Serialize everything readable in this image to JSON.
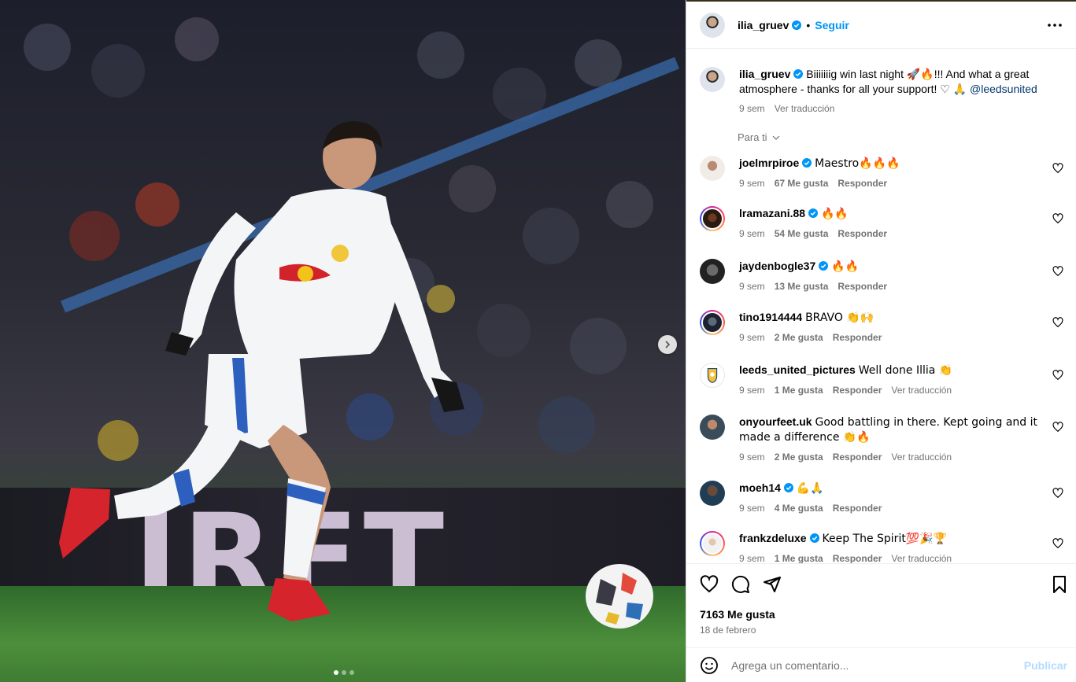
{
  "post": {
    "author": "ilia_gruev",
    "follow_label": "Seguir",
    "separator": "•",
    "caption_pre": "Biiiiiiig win last night ",
    "caption_emoji": "🚀🔥",
    "caption_post": "!!! And what a great atmosphere - thanks for all your support! ♡ 🙏 ",
    "caption_mention": "@leedsunited",
    "caption_age": "9 sem",
    "see_translation": "Ver traducción",
    "filter_label": "Para ti",
    "likes": "7163 Me gusta",
    "date": "18 de febrero"
  },
  "media": {
    "board_text": "IRFT",
    "slides": 3,
    "active_slide": 0
  },
  "comments": [
    {
      "user": "joelmrpiroe",
      "verified": true,
      "text": "Maestro🔥🔥🔥",
      "age": "9 sem",
      "likes": "67 Me gusta",
      "reply": "Responder",
      "translate": ""
    },
    {
      "user": "lramazani.88",
      "verified": true,
      "text": "🔥🔥",
      "age": "9 sem",
      "likes": "54 Me gusta",
      "reply": "Responder",
      "translate": ""
    },
    {
      "user": "jaydenbogle37",
      "verified": true,
      "text": "🔥🔥",
      "age": "9 sem",
      "likes": "13 Me gusta",
      "reply": "Responder",
      "translate": ""
    },
    {
      "user": "tino1914444",
      "verified": false,
      "text": "BRAVO 👏🙌",
      "age": "9 sem",
      "likes": "2 Me gusta",
      "reply": "Responder",
      "translate": ""
    },
    {
      "user": "leeds_united_pictures",
      "verified": false,
      "text": "Well done Illia 👏",
      "age": "9 sem",
      "likes": "1 Me gusta",
      "reply": "Responder",
      "translate": "Ver traducción"
    },
    {
      "user": "onyourfeet.uk",
      "verified": false,
      "text": "Good battling in there. Kept going and it made a difference 👏🔥",
      "age": "9 sem",
      "likes": "2 Me gusta",
      "reply": "Responder",
      "translate": "Ver traducción"
    },
    {
      "user": "moeh14",
      "verified": true,
      "text": "💪🙏",
      "age": "9 sem",
      "likes": "4 Me gusta",
      "reply": "Responder",
      "translate": ""
    },
    {
      "user": "frankzdeluxe",
      "verified": true,
      "text": "Keep The Spirit💯🎉🏆",
      "age": "9 sem",
      "likes": "1 Me gusta",
      "reply": "Responder",
      "translate": "Ver traducción"
    }
  ],
  "composer": {
    "placeholder": "Agrega un comentario...",
    "publish_label": "Publicar"
  },
  "icons": [
    "more-icon",
    "verified-icon",
    "heart-icon",
    "comment-icon",
    "share-icon",
    "bookmark-icon",
    "emoji-icon",
    "chevron-right-icon",
    "chevron-down-icon"
  ],
  "colors": {
    "link": "#0095f6",
    "verified": "#0095f6",
    "muted": "#737373",
    "publish_disabled": "#b3dbff"
  }
}
